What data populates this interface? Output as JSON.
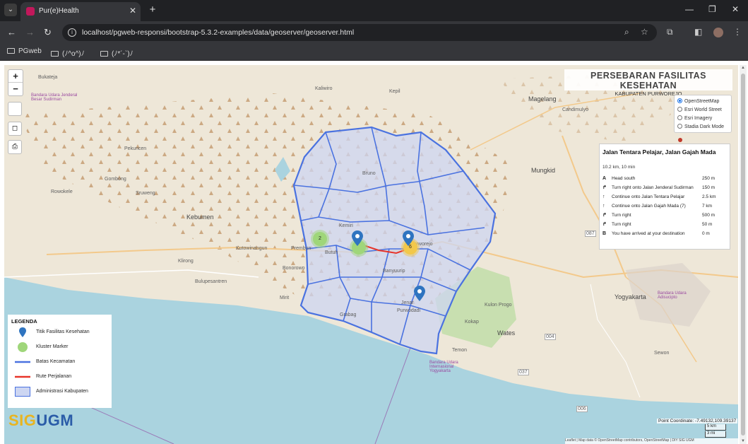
{
  "browser": {
    "tab_title": "Pur(e)Health",
    "tab_close": "✕",
    "new_tab": "+",
    "url": "localhost/pgweb-responsi/bootstrap-5.3.2-examples/data/geoserver/geoserver.html",
    "window_controls": [
      "—",
      "❐",
      "✕"
    ],
    "bookmarks": [
      "PGweb",
      "(ﾉ^o^)ﾉ",
      "(ﾉ*´-`)ﾉ"
    ]
  },
  "map": {
    "title": "PERSEBARAN FASILITAS KESEHATAN",
    "subtitle": "KABUPATEN PURWOREJO",
    "zoom_in": "+",
    "zoom_out": "−",
    "basemaps": [
      {
        "label": "OpenStreetMap",
        "selected": true
      },
      {
        "label": "Esri World Street",
        "selected": false
      },
      {
        "label": "Esri Imagery",
        "selected": false
      },
      {
        "label": "Stadia Dark Mode",
        "selected": false
      }
    ],
    "place_labels": {
      "bukateja": "Bukateja",
      "kaliwiro": "Kaliwiro",
      "kepil": "Kepil",
      "magelang": "Magelang",
      "candimulyo": "Candimulyo",
      "pekuncen": "Pekuncen",
      "gombong": "Gombong",
      "kebumen": "Kebumen",
      "mungkid": "Mungkid",
      "kemiri": "Kemiri",
      "bruno": "Bruno",
      "purworejo": "Purworejo",
      "butuh": "Butuh",
      "prembun": "Prembun",
      "kutowinangun": "Kutowinangun",
      "klirong": "Klirong",
      "bonorowo": "Bonorowo",
      "banyuurip": "Banyuurip",
      "bulupesantren": "Bulupesantren",
      "mirit": "Mirit",
      "grabag": "Grabag",
      "jenar": "Jenar",
      "purwodadi": "Purwodadi",
      "kulon_progo": "Kulon Progo",
      "yogyakarta": "Yogyakarta",
      "wates": "Wates",
      "kokap": "Kokap",
      "temon": "Temon",
      "sewon": "Sewon",
      "sruweng": "Sruweng",
      "rowokele": "Rowokele",
      "bandara_jsudirman": "Bandara Udara Jenderal Besar Sudirman",
      "bandara_yia": "Bandara Udara Internasional Yogyakarta",
      "bandara_adisucipto": "Bandara Udara Adisucipto"
    },
    "route_panel": {
      "title": "Jalan Tentara Pelajar, Jalan Gajah Mada",
      "summary": "10.2 km, 10 min",
      "steps": [
        {
          "icon": "A",
          "text": "Head south",
          "dist": "250 m"
        },
        {
          "icon": "↱",
          "text": "Turn right onto Jalan Jenderal Sudirman",
          "dist": "150 m"
        },
        {
          "icon": "↑",
          "text": "Continue onto Jalan Tentara Pelajar",
          "dist": "2.5 km"
        },
        {
          "icon": "↑",
          "text": "Continue onto Jalan Gajah Mada (7)",
          "dist": "7 km"
        },
        {
          "icon": "↱",
          "text": "Turn right",
          "dist": "500 m"
        },
        {
          "icon": "↱",
          "text": "Turn right",
          "dist": "50 m"
        },
        {
          "icon": "B",
          "text": "You have arrived at your destination",
          "dist": "0 m"
        }
      ]
    },
    "legend": {
      "title": "LEGENDA",
      "items": [
        "Titik Fasilitas Kesehatan",
        "Kluster Marker",
        "Batas Kecamatan",
        "Rute Perjalanan",
        "Administrasi Kabupaten"
      ]
    },
    "clusters": [
      "2",
      "6"
    ],
    "logo_sig": "SIG",
    "logo_ugm": "UGM",
    "point_coordinate": "Point Coordinate: -7.49132,109.39137",
    "scale_km": "5 km",
    "scale_mi": "3 mi",
    "attribution": "Leaflet | Map data © OpenStreetMap contributors, OpenStreetMap | DIY SIG UGM",
    "road_labels": [
      "087",
      "004",
      "037",
      "006"
    ],
    "colors": {
      "boundary": "#4a72e0",
      "admin_fill": "#cdd6f2",
      "route": "#e8352a",
      "cluster_green": "#9fd67a",
      "cluster_yellow": "#f2c84b",
      "sea": "#aad3df",
      "land": "#eee7d8",
      "ugm_blue": "#2b5ca8",
      "sig_yellow": "#e8b420"
    }
  }
}
